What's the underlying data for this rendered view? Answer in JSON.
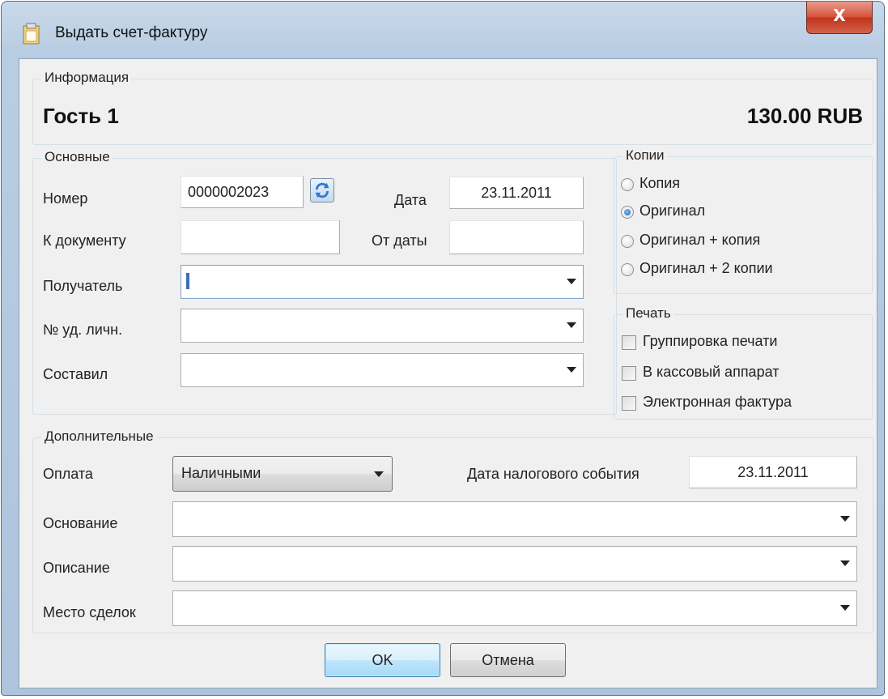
{
  "window": {
    "title": "Выдать счет-фактуру",
    "close_label": "X",
    "icon": "document-icon"
  },
  "info": {
    "group_title": "Информация",
    "guest": "Гость 1",
    "amount": "130.00 RUB"
  },
  "main": {
    "group_title": "Основные",
    "number_label": "Номер",
    "number_value": "0000002023",
    "date_label": "Дата",
    "date_value": "23.11.2011",
    "to_document_label": "К документу",
    "to_document_value": "",
    "from_date_label": "От даты",
    "from_date_value": "",
    "recipient_label": "Получатель",
    "recipient_value": "",
    "id_label": "№ уд. личн.",
    "id_value": "",
    "composed_label": "Составил",
    "composed_value": ""
  },
  "copies": {
    "group_title": "Копии",
    "options": [
      "Копия",
      "Оригинал",
      "Оригинал + копия",
      "Оригинал + 2 копии"
    ],
    "selected": "Оригинал"
  },
  "print": {
    "group_title": "Печать",
    "options": [
      "Группировка печати",
      "В кассовый аппарат",
      "Электронная фактура"
    ],
    "checked": [
      false,
      false,
      false
    ]
  },
  "extra": {
    "group_title": "Дополнительные",
    "payment_label": "Оплата",
    "payment_value": "Наличными",
    "tax_date_label": "Дата налогового события",
    "tax_date_value": "23.11.2011",
    "basis_label": "Основание",
    "basis_value": "",
    "description_label": "Описание",
    "description_value": "",
    "place_label": "Место сделок",
    "place_value": ""
  },
  "buttons": {
    "ok": "OK",
    "cancel": "Отмена"
  },
  "colors": {
    "title_bar": "#b9cde2",
    "close_button": "#d6543c",
    "client_bg": "#f0f0f0",
    "default_button": "#bee6fd"
  }
}
